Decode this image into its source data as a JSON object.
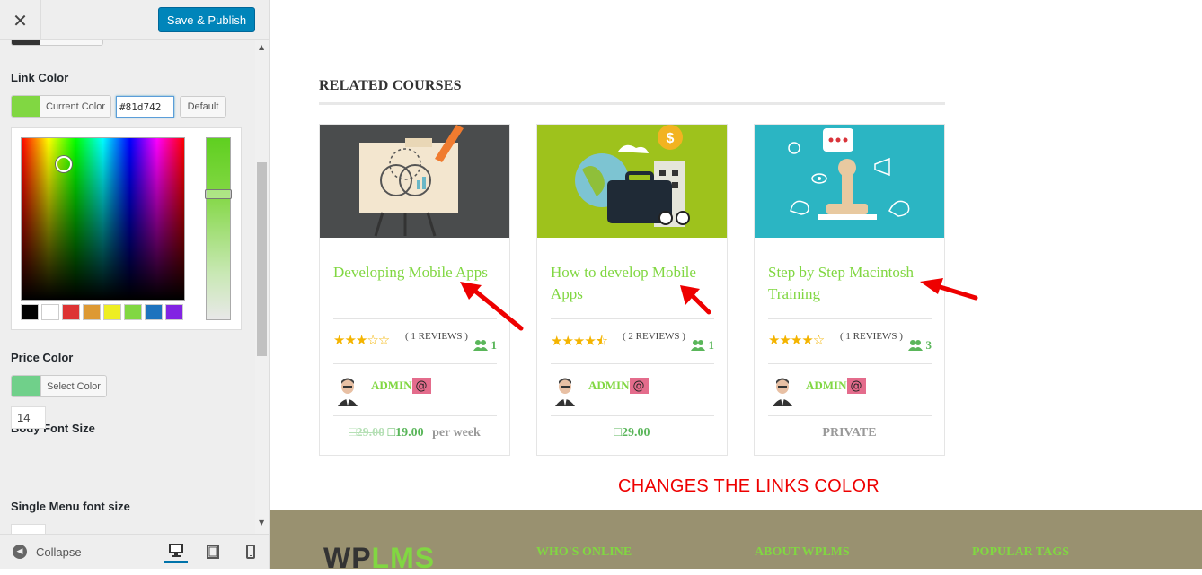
{
  "customizer": {
    "close_glyph": "✕",
    "save_label": "Save & Publish",
    "link_color": {
      "title": "Link Color",
      "swatch": "#81d742",
      "button_label": "Current Color",
      "hex_value": "#81d742",
      "default_label": "Default",
      "palette": [
        "#000000",
        "#ffffff",
        "#dd3333",
        "#dd9933",
        "#eeee22",
        "#81d742",
        "#1e73be",
        "#8224e3"
      ]
    },
    "price_color": {
      "title": "Price Color",
      "swatch": "#70d08a",
      "button_label": "Select Color"
    },
    "body_font_size": {
      "title": "Body Font Size",
      "value": "14"
    },
    "single_menu_font_size": {
      "title": "Single Menu font size"
    },
    "collapse_label": "Collapse",
    "devices": [
      "desktop-icon",
      "tablet-icon",
      "mobile-icon"
    ]
  },
  "preview": {
    "section_title": "RELATED COURSES",
    "courses": [
      {
        "title": "Developing Mobile Apps",
        "rating": 3,
        "reviews": "( 1 REVIEWS )",
        "students": "1",
        "author": "ADMIN",
        "badge": "@",
        "price_old": "29.00",
        "price_new": "19.00",
        "price_suffix": "per week",
        "currency_glyph": "□"
      },
      {
        "title": "How to develop Mobile Apps",
        "rating": 4.5,
        "reviews": "( 2 REVIEWS )",
        "students": "1",
        "author": "ADMIN",
        "badge": "@",
        "price_new": "29.00",
        "currency_glyph": "□"
      },
      {
        "title": "Step by Step Macintosh Training",
        "rating": 4,
        "reviews": "( 1 REVIEWS )",
        "students": "3",
        "author": "ADMIN",
        "badge": "@",
        "price_text": "PRIVATE"
      }
    ],
    "annotation": "CHANGES THE LINKS COLOR",
    "footer": {
      "logo_dark": "WP",
      "logo_green": "LMS",
      "headings": [
        "WHO'S ONLINE",
        "ABOUT WPLMS",
        "POPULAR TAGS"
      ]
    }
  },
  "colors": {
    "link": "#81d742",
    "primary_button": "#0085ba",
    "annotation_red": "#e00000",
    "footer_bg": "#999170"
  }
}
